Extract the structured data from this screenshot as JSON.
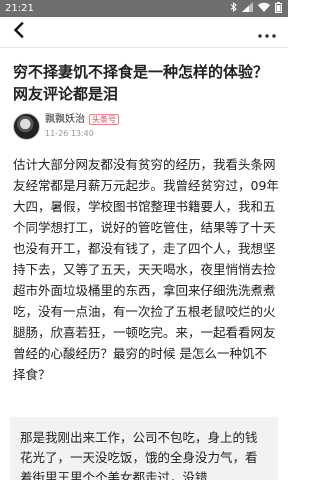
{
  "status_bar": {
    "time": "21:21",
    "icons": [
      "bluetooth-icon",
      "signal-icon",
      "wifi-icon",
      "battery-icon"
    ]
  },
  "nav": {
    "back_icon": "chevron-left-icon",
    "more_icon": "more-dots-icon"
  },
  "article": {
    "title": "穷不择妻饥不择食是一种怎样的体验？网友评论都是泪",
    "author": {
      "name": "飘飘妖治",
      "badge": "头条号",
      "time": "11-26 13:40"
    },
    "body": "估计大部分网友都没有贫穷的经历，我看头条网友经常都是月薪万元起步。我曾经贫穷过，09年大四，暑假，学校图书馆整理书籍要人，我和五个同学想打工，说好的管吃管住，结果等了十天也没有开工，都没有钱了，走了四个人，我想坚持下去，又等了五天，天天喝水，夜里悄悄去捡超市外面垃圾桶里的东西，拿回来仔细洗洗煮煮吃，没有一点油，有一次捡了五根老鼠咬烂的火腿肠，欣喜若狂，一顿吃完。来，一起看看网友曾经的心酸经历？最穷的时候 是怎么一种饥不择食？",
    "comment": "那是我刚出来工作，公司不包吃，身上的钱花光了，一天没吃饭，饿的全身没力气，看着街里王里个个美女都走过，没错"
  },
  "colors": {
    "status_bar_bg": "#6e6e6e",
    "badge": "#e0454b",
    "comment_bg": "#f2f2f2"
  }
}
